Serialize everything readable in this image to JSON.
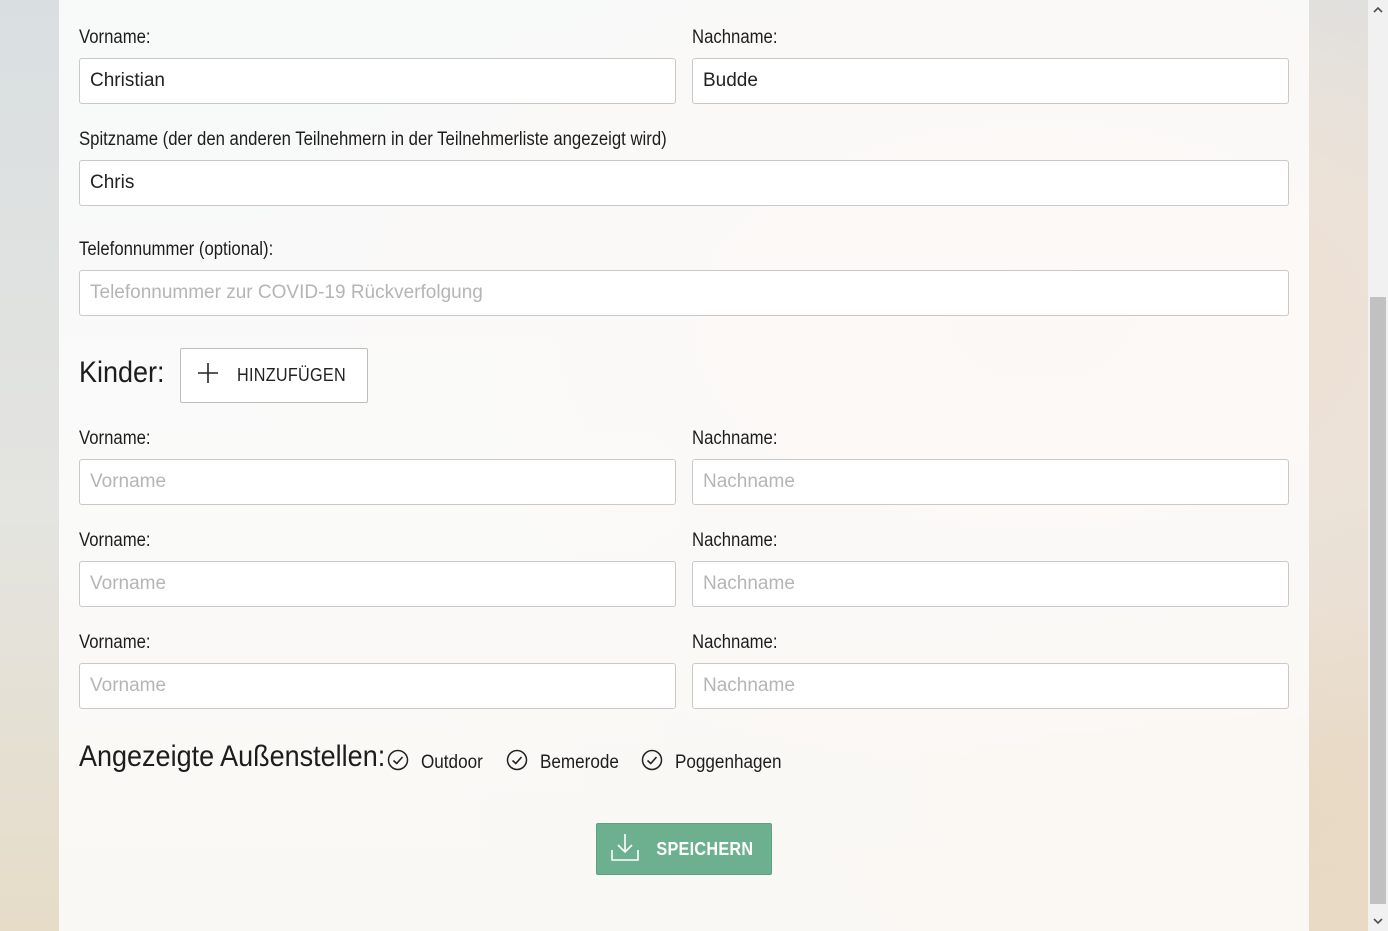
{
  "parent": {
    "first_name_label": "Vorname:",
    "first_name_value": "Christian",
    "last_name_label": "Nachname:",
    "last_name_value": "Budde",
    "nickname_label": "Spitzname (der den anderen Teilnehmern in der Teilnehmerliste angezeigt wird)",
    "nickname_value": "Chris",
    "phone_label": "Telefonnummer (optional):",
    "phone_placeholder": "Telefonnummer zur COVID-19 Rückverfolgung",
    "phone_value": ""
  },
  "children": {
    "heading": "Kinder:",
    "add_button_label": "HINZUFÜGEN",
    "rows": [
      {
        "first_label": "Vorname:",
        "first_placeholder": "Vorname",
        "last_label": "Nachname:",
        "last_placeholder": "Nachname"
      },
      {
        "first_label": "Vorname:",
        "first_placeholder": "Vorname",
        "last_label": "Nachname:",
        "last_placeholder": "Nachname"
      },
      {
        "first_label": "Vorname:",
        "first_placeholder": "Vorname",
        "last_label": "Nachname:",
        "last_placeholder": "Nachname"
      }
    ]
  },
  "locations": {
    "heading": "Angezeigte Außenstellen:",
    "options": [
      {
        "label": "Outdoor",
        "checked": true
      },
      {
        "label": "Bemerode",
        "checked": true
      },
      {
        "label": "Poggenhagen",
        "checked": true
      }
    ]
  },
  "save_button_label": "SPEICHERN",
  "colors": {
    "save_button": "#6db08f",
    "panel": "#ffffff"
  },
  "icons": {
    "add": "plus-icon",
    "check": "check-circle-icon",
    "save": "download-icon"
  }
}
